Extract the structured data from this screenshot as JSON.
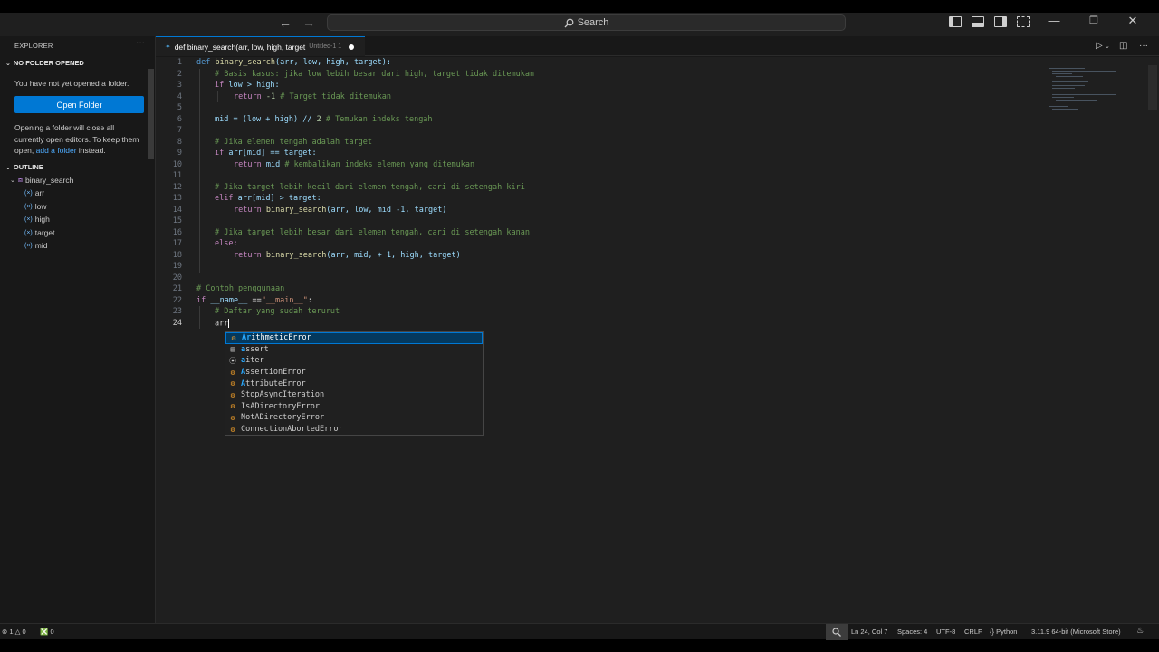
{
  "titlebar": {
    "search_label": "Search"
  },
  "sidebar": {
    "explorer_title": "EXPLORER",
    "more": "···",
    "no_folder_title": "NO FOLDER OPENED",
    "no_folder_msg": "You have not yet opened a folder.",
    "open_folder_label": "Open Folder",
    "info_line1": "Opening a folder will close all",
    "info_line2": "currently open editors. To keep them",
    "info_line3_pre": "open, ",
    "info_link": "add a folder",
    "info_line3_post": " instead.",
    "outline_title": "OUTLINE",
    "outline_root": "binary_search",
    "outline_items": [
      "arr",
      "low",
      "high",
      "target",
      "mid"
    ]
  },
  "tab": {
    "label": "def binary_search(arr, low, high, target",
    "sub": "Untitled-1 1"
  },
  "editor": {
    "line_numbers": [
      "1",
      "2",
      "3",
      "4",
      "5",
      "6",
      "7",
      "8",
      "9",
      "10",
      "11",
      "12",
      "13",
      "14",
      "15",
      "16",
      "17",
      "18",
      "19",
      "20",
      "21",
      "22",
      "23",
      "24"
    ],
    "active_line": "24",
    "code": {
      "l1_def": "def",
      "l1_fn": "binary_search",
      "l1_params": "(arr, low, high, target):",
      "l2": "# Basis kasus: jika low lebih besar dari high, target tidak ditemukan",
      "l3_if": "if",
      "l3_rest": "low > high:",
      "l4_ret": "return",
      "l4_num": "-1",
      "l4_cmt": "# Target tidak ditemukan",
      "l6_a": "mid = (low + high) //",
      "l6_num": "2",
      "l6_cmt": "# Temukan indeks tengah",
      "l8": "# Jika elemen tengah adalah target",
      "l9_if": "if",
      "l9_rest": "arr[mid] == target:",
      "l10_ret": "return",
      "l10_var": "mid",
      "l10_cmt": "# kembalikan indeks elemen yang ditemukan",
      "l12": "# Jika target lebih kecil dari elemen tengah, cari di setengah kiri",
      "l13_elif": "elif",
      "l13_rest": "arr[mid] > target:",
      "l14_ret": "return",
      "l14_fn": "binary_search",
      "l14_rest": "(arr, low, mid -1, target)",
      "l16": "# Jika target lebih besar dari elemen tengah, cari di setengah kanan",
      "l17_else": "else:",
      "l18_ret": "return",
      "l18_fn": "binary_search",
      "l18_rest": "(arr, mid, + 1, high, target)",
      "l21": "# Contoh penggunaan",
      "l22_if": "if",
      "l22_name": "__name__",
      "l22_eq": "==",
      "l22_str": "\"__main__\"",
      "l22_colon": ":",
      "l23": "# Daftar yang sudah terurut",
      "l24": "arr"
    }
  },
  "suggestions": [
    {
      "match": "Ar",
      "rest": "ithmeticError",
      "kind": "class"
    },
    {
      "match": "a",
      "rest": "ssert",
      "kind": "keyword"
    },
    {
      "match": "a",
      "rest": "iter",
      "kind": "function"
    },
    {
      "match": "A",
      "rest": "ssertionError",
      "kind": "class"
    },
    {
      "match": "A",
      "rest": "ttributeError",
      "kind": "class"
    },
    {
      "match": "",
      "rest": "StopAsyncIteration",
      "kind": "class"
    },
    {
      "match": "",
      "rest": "IsADirectoryError",
      "kind": "class"
    },
    {
      "match": "",
      "rest": "NotADirectoryError",
      "kind": "class"
    },
    {
      "match": "",
      "rest": "ConnectionAbortedError",
      "kind": "class"
    }
  ],
  "statusbar": {
    "errors": "1",
    "warnings": "0",
    "ports": "0",
    "position": "Ln 24, Col 7",
    "spaces": "Spaces: 4",
    "encoding": "UTF-8",
    "eol": "CRLF",
    "language": "Python",
    "interpreter": "3.11.9 64-bit (Microsoft Store)"
  }
}
